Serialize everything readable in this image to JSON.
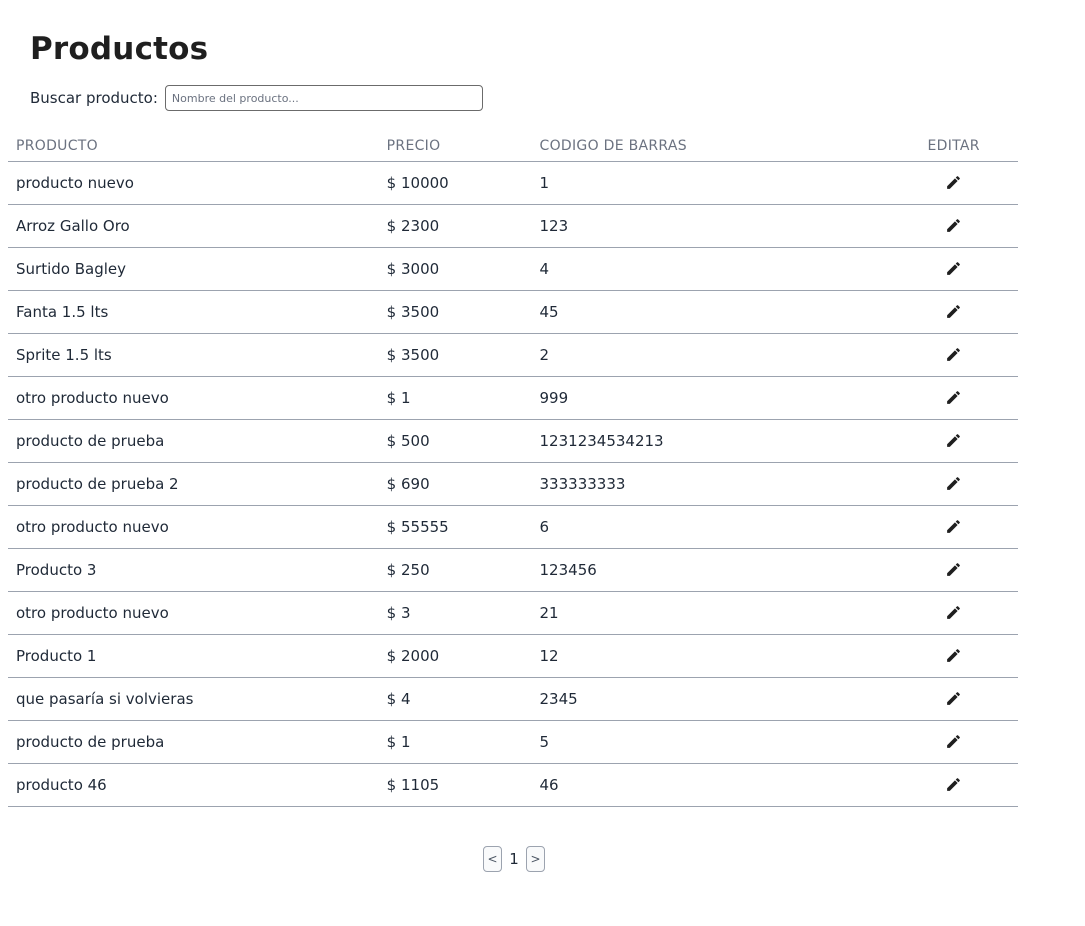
{
  "header": {
    "title": "Productos"
  },
  "search": {
    "label": "Buscar producto:",
    "placeholder": "Nombre del producto...",
    "value": ""
  },
  "table": {
    "columns": {
      "product": "PRODUCTO",
      "price": "PRECIO",
      "barcode": "CODIGO DE BARRAS",
      "edit": "EDITAR"
    },
    "rows": [
      {
        "product": "producto nuevo",
        "price": "$ 10000",
        "barcode": "1"
      },
      {
        "product": "Arroz Gallo Oro",
        "price": "$ 2300",
        "barcode": "123"
      },
      {
        "product": "Surtido Bagley",
        "price": "$ 3000",
        "barcode": "4"
      },
      {
        "product": "Fanta 1.5 lts",
        "price": "$ 3500",
        "barcode": "45"
      },
      {
        "product": "Sprite 1.5 lts",
        "price": "$ 3500",
        "barcode": "2"
      },
      {
        "product": "otro producto nuevo",
        "price": "$ 1",
        "barcode": "999"
      },
      {
        "product": "producto de prueba",
        "price": "$ 500",
        "barcode": "1231234534213"
      },
      {
        "product": "producto de prueba 2",
        "price": "$ 690",
        "barcode": "333333333"
      },
      {
        "product": "otro producto nuevo",
        "price": "$ 55555",
        "barcode": "6"
      },
      {
        "product": "Producto 3",
        "price": "$ 250",
        "barcode": "123456"
      },
      {
        "product": "otro producto nuevo",
        "price": "$ 3",
        "barcode": "21"
      },
      {
        "product": "Producto 1",
        "price": "$ 2000",
        "barcode": "12"
      },
      {
        "product": "que pasaría si volvieras",
        "price": "$ 4",
        "barcode": "2345"
      },
      {
        "product": "producto de prueba",
        "price": "$ 1",
        "barcode": "5"
      },
      {
        "product": "producto 46",
        "price": "$ 1105",
        "barcode": "46"
      }
    ],
    "edit_icon": "pencil-icon"
  },
  "pagination": {
    "prev_label": "<",
    "current_page": "1",
    "next_label": ">"
  },
  "colors": {
    "header_text": "#6b7280",
    "row_border": "#9ca3af",
    "text": "#1f2937"
  }
}
